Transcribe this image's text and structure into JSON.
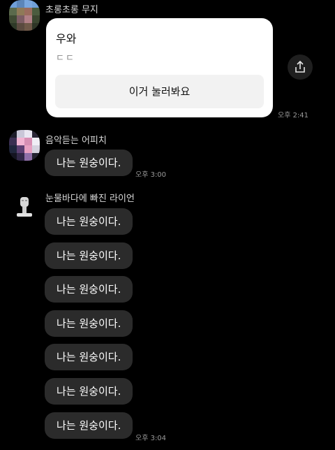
{
  "messages": {
    "muzi": {
      "sender": "초롱초롱 무지",
      "card_title": "우와",
      "card_sub": "ㄷㄷ",
      "card_button": "이거 눌러봐요",
      "time": "오후 2:41"
    },
    "apeach": {
      "sender": "음악듣는 어피치",
      "text": "나는 원숭이다.",
      "time": "오후 3:00"
    },
    "ryan": {
      "sender": "눈물바다에 빠진 라이언",
      "texts": [
        "나는 원숭이다.",
        "나는 원숭이다.",
        "나는 원숭이다.",
        "나는 원숭이다.",
        "나는 원숭이다.",
        "나는 원숭이다.",
        "나는 원숭이다."
      ],
      "time": "오후 3:04"
    }
  },
  "icons": {
    "share": "share-icon"
  },
  "colors": {
    "background": "#000000",
    "bubble": "#2b2b2b",
    "card": "#ffffff"
  }
}
